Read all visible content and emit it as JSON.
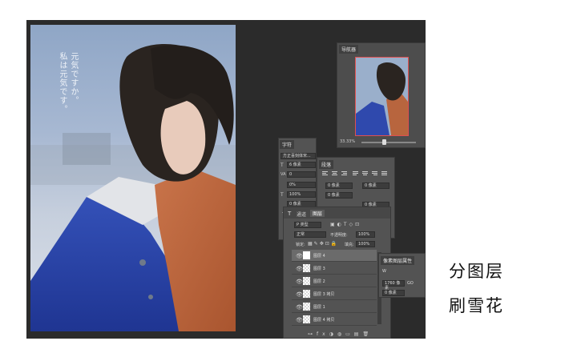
{
  "poem": {
    "line1": "元気ですか。",
    "line2": "私は元気です。"
  },
  "navigator": {
    "tab": "导航器",
    "zoom": "33.33%"
  },
  "character": {
    "tab": "字符",
    "font": "方正喜刻体宋...",
    "size": "6 像素",
    "tracking": "0",
    "scale_v": "0%",
    "scale_h": "100%",
    "baseline": "0 像素",
    "color_label": "颜色"
  },
  "paragraph": {
    "tab": "段落",
    "indent1": "0 像素",
    "indent2": "0 像素",
    "indent3": "0 像素",
    "indent4": "0 像素"
  },
  "layers": {
    "tab_channels": "通道",
    "tab_layers": "图层",
    "kind": "P 类型",
    "blend_mode": "正常",
    "opacity_label": "不透明度:",
    "opacity": "100%",
    "lock_label": "锁定:",
    "fill_label": "填充:",
    "fill": "100%",
    "items": [
      {
        "name": "图层 4"
      },
      {
        "name": "图层 3"
      },
      {
        "name": "图层 2"
      },
      {
        "name": "图层 3 拷贝"
      },
      {
        "name": "图层 1"
      },
      {
        "name": "图层 4 拷贝"
      }
    ]
  },
  "properties": {
    "tab": "像素图层属性",
    "width_label": "W",
    "width": "1760 像素",
    "link_symbol": "GO",
    "x_value": "0 像素"
  },
  "caption": {
    "line1": "分图层",
    "line2": "刷雪花"
  }
}
